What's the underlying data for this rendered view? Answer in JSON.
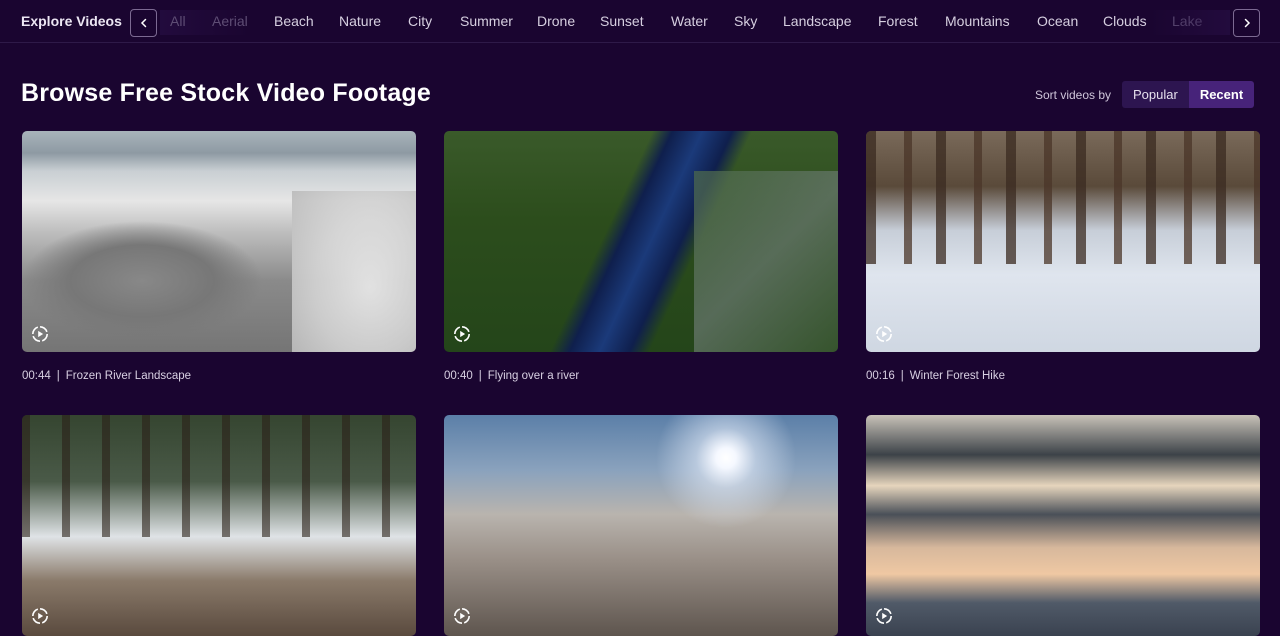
{
  "topbar": {
    "title": "Explore Videos",
    "prev_icon": "chevron-left-icon",
    "next_icon": "chevron-right-icon",
    "categories": [
      {
        "label": "All",
        "state": "faded"
      },
      {
        "label": "Aerial",
        "state": "faded"
      },
      {
        "label": "Beach",
        "state": "normal"
      },
      {
        "label": "Nature",
        "state": "normal"
      },
      {
        "label": "City",
        "state": "normal"
      },
      {
        "label": "Summer",
        "state": "normal"
      },
      {
        "label": "Drone",
        "state": "normal"
      },
      {
        "label": "Sunset",
        "state": "normal"
      },
      {
        "label": "Water",
        "state": "normal"
      },
      {
        "label": "Sky",
        "state": "normal"
      },
      {
        "label": "Landscape",
        "state": "normal"
      },
      {
        "label": "Forest",
        "state": "normal"
      },
      {
        "label": "Mountains",
        "state": "normal"
      },
      {
        "label": "Ocean",
        "state": "normal"
      },
      {
        "label": "Clouds",
        "state": "normal"
      },
      {
        "label": "Lake",
        "state": "faded"
      }
    ]
  },
  "main": {
    "title": "Browse Free Stock Video Footage",
    "sort": {
      "label": "Sort videos by",
      "options": [
        "Popular",
        "Recent"
      ],
      "selected": "Recent"
    },
    "videos": [
      {
        "duration": "00:44",
        "title": "Frozen River Landscape",
        "play_icon": "play-circle-icon"
      },
      {
        "duration": "00:40",
        "title": "Flying over a river",
        "play_icon": "play-circle-icon"
      },
      {
        "duration": "00:16",
        "title": "Winter Forest Hike",
        "play_icon": "play-circle-icon"
      },
      {
        "duration": "",
        "title": "",
        "play_icon": "play-circle-icon"
      },
      {
        "duration": "",
        "title": "",
        "play_icon": "play-circle-icon"
      },
      {
        "duration": "",
        "title": "",
        "play_icon": "play-circle-icon"
      }
    ],
    "separator": "|"
  },
  "colors": {
    "background": "#1a0530",
    "sort_popular_bg": "#2d1550",
    "sort_recent_bg": "#47237a"
  }
}
